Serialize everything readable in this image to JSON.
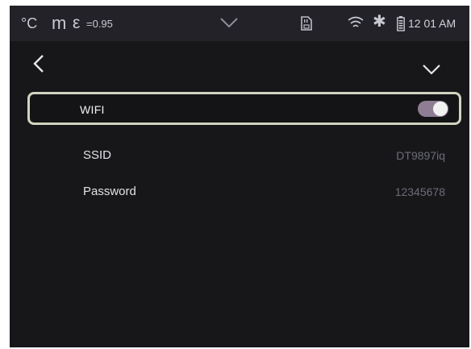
{
  "status_bar": {
    "temp_unit": "°C",
    "distance_unit": "m",
    "emissivity_symbol": "ε",
    "emissivity_value": "=0.95",
    "flash_glyph": "✱",
    "time": "12 01 AM",
    "icons": [
      "chevron-down-icon",
      "sd-card-icon",
      "wifi-icon",
      "flash-icon",
      "battery-icon"
    ]
  },
  "nav": {
    "back_icon": "chevron-left-icon",
    "collapse_icon": "chevron-down-icon"
  },
  "settings": {
    "wifi": {
      "label": "WIFI",
      "enabled": true
    },
    "ssid": {
      "label": "SSID",
      "value": "DT9897iq"
    },
    "password": {
      "label": "Password",
      "value": "12345678"
    }
  },
  "colors": {
    "background": "#17171a",
    "status_bar": "#222228",
    "focus_border": "#d2d3bf",
    "toggle_on": "#8f7d94",
    "value_text": "#6c6c78"
  }
}
